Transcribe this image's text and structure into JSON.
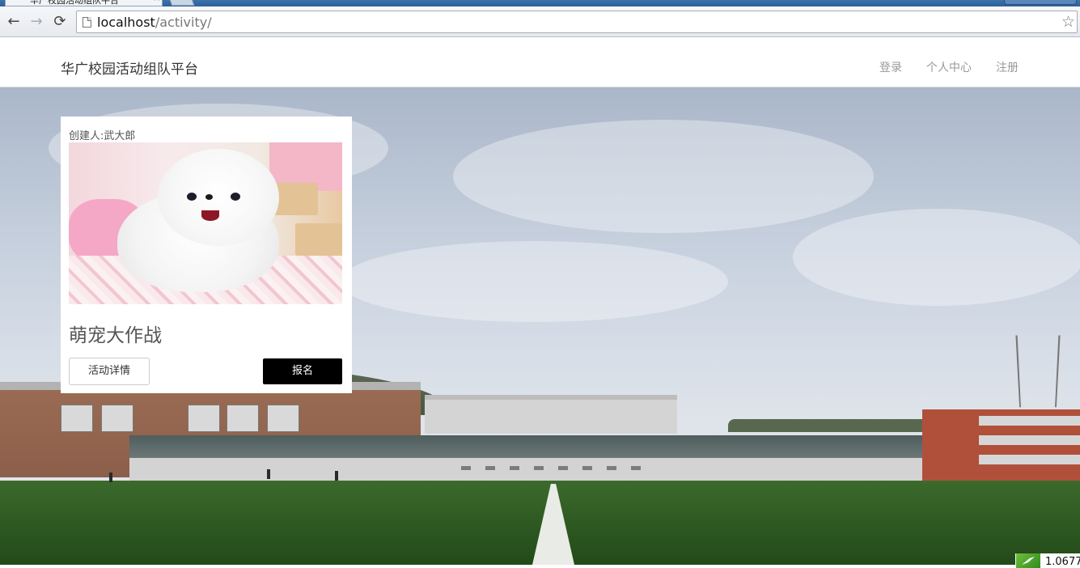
{
  "browser": {
    "tab_title": "华广校园活动组队平台",
    "tab_close": "×",
    "url_host": "localhost",
    "url_path": "/activity/",
    "back_glyph": "←",
    "forward_glyph": "→",
    "reload_glyph": "⟳",
    "star_glyph": "☆"
  },
  "header": {
    "brand": "华广校园活动组队平台",
    "nav": [
      "登录",
      "个人中心",
      "注册"
    ]
  },
  "card": {
    "creator": "创建人:武大郎",
    "title": "萌宠大作战",
    "detail_button": "活动详情",
    "signup_button": "报名"
  },
  "overlay": {
    "speed_value": "1.0677"
  },
  "colors": {
    "signup_button_bg": "#000000",
    "nav_link": "#999999",
    "brand_text": "#333333"
  },
  "icons": [
    "back-icon",
    "forward-icon",
    "reload-icon",
    "page-icon",
    "bookmark-star-icon",
    "speed-icon"
  ]
}
